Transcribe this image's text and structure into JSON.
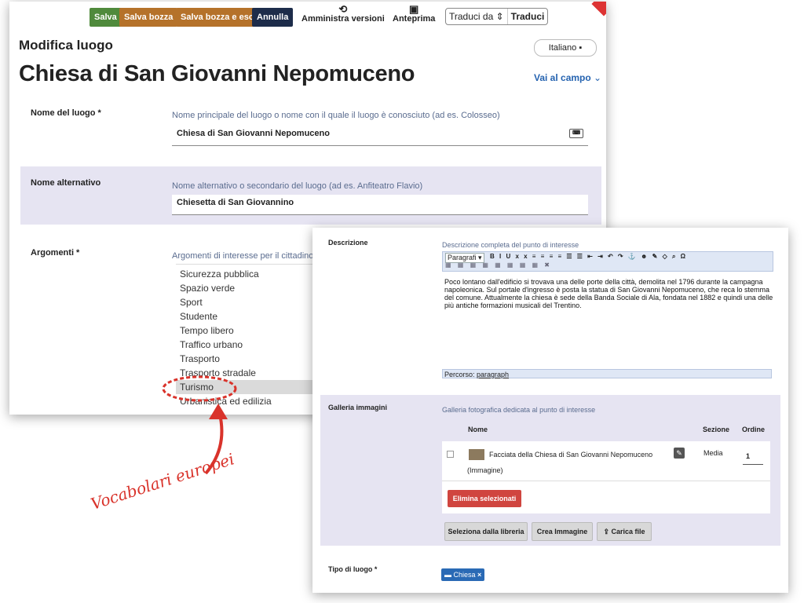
{
  "toolbar": {
    "save": "Salva",
    "save_draft": "Salva bozza",
    "save_draft_exit": "Salva bozza e esci",
    "cancel": "Annulla",
    "versions": "Amministra versioni",
    "preview": "Anteprima",
    "translate_from": "Traduci da",
    "translate": "Traduci"
  },
  "header": {
    "subtitle": "Modifica luogo",
    "title": "Chiesa di San Giovanni Nepomuceno",
    "language": "Italiano",
    "goto_field": "Vai al campo"
  },
  "fields": {
    "name": {
      "label": "Nome del luogo *",
      "help": "Nome principale del luogo o nome con il quale il luogo è conosciuto (ad es. Colosseo)",
      "value": "Chiesa di San Giovanni Nepomuceno"
    },
    "alt_name": {
      "label": "Nome alternativo",
      "help": "Nome alternativo o secondario del luogo (ad es. Anfiteatro Flavio)",
      "value": "Chiesetta di San Giovannino"
    },
    "topics": {
      "label": "Argomenti *",
      "help": "Argomenti di interesse per il cittadino",
      "items": [
        "Sicurezza pubblica",
        "Spazio verde",
        "Sport",
        "Studente",
        "Tempo libero",
        "Traffico urbano",
        "Trasporto",
        "Trasporto stradale",
        "Turismo",
        "Urbanistica ed edilizia"
      ],
      "selected": "Turismo"
    }
  },
  "front": {
    "description": {
      "label": "Descrizione",
      "help": "Descrizione completa del punto di interesse",
      "format": "Paragrafi",
      "text": "Poco lontano dall'edificio si trovava una delle porte della città, demolita nel 1796 durante la campagna napoleonica. Sul portale d'ingresso è posta la statua di San Giovanni Nepomuceno, che reca lo stemma del comune. Attualmente la chiesa è sede della Banda Sociale di Ala, fondata nel 1882 e quindi una delle più antiche formazioni musicali del Trentino.",
      "path_label": "Percorso:",
      "path_value": "paragraph"
    },
    "gallery": {
      "label": "Galleria immagini",
      "help": "Galleria fotografica dedicata al punto di interesse",
      "col_name": "Nome",
      "col_section": "Sezione",
      "col_order": "Ordine",
      "item_name": "Facciata della Chiesa di San Giovanni Nepomuceno",
      "item_type": "(Immagine)",
      "item_section": "Media",
      "item_order": "1",
      "delete_selected": "Elimina selezionati",
      "select_library": "Seleziona dalla libreria",
      "create_image": "Crea Immagine",
      "upload_file": "Carica file"
    },
    "place_type": {
      "label": "Tipo di luogo *",
      "tag": "Chiesa"
    }
  },
  "annotation": "Vocabolari europei",
  "colors": {
    "accent_red": "#d9332b",
    "save_green": "#4f8a3c",
    "draft_brown": "#b5722a",
    "cancel_navy": "#1d2c4a",
    "link_blue": "#2563b0",
    "row_bg": "#e6e4f2"
  }
}
